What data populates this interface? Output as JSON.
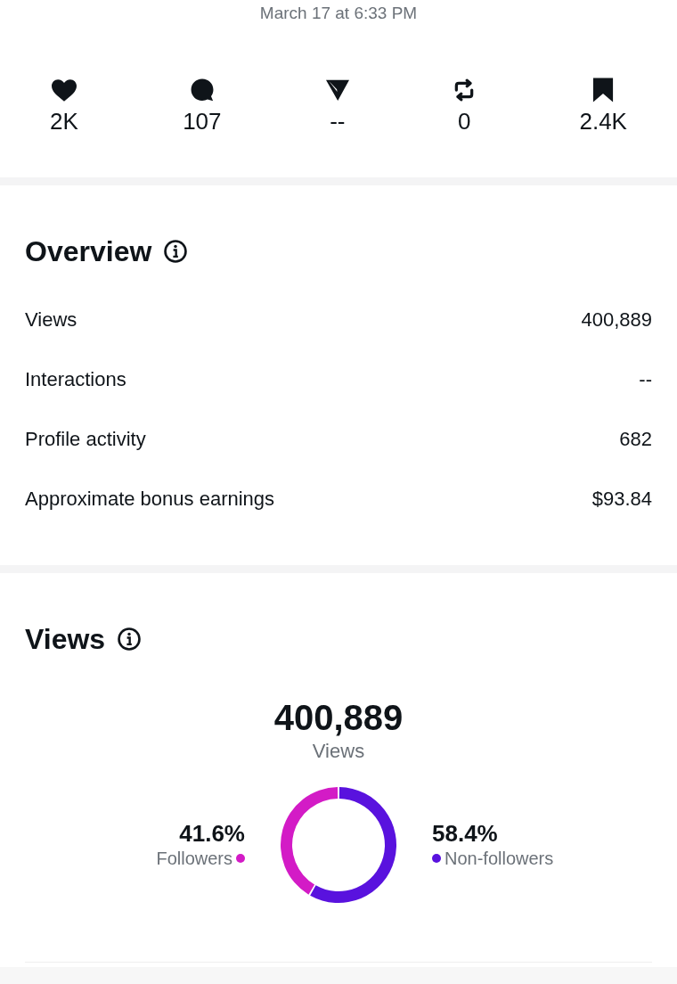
{
  "post": {
    "timestamp": "March 17 at 6:33 PM"
  },
  "stats": [
    {
      "kind": "likes",
      "value": "2K"
    },
    {
      "kind": "comments",
      "value": "107"
    },
    {
      "kind": "shares",
      "value": "--"
    },
    {
      "kind": "reposts",
      "value": "0"
    },
    {
      "kind": "saves",
      "value": "2.4K"
    }
  ],
  "overview": {
    "title": "Overview",
    "rows": [
      {
        "label": "Views",
        "value": "400,889"
      },
      {
        "label": "Interactions",
        "value": "--"
      },
      {
        "label": "Profile activity",
        "value": "682"
      },
      {
        "label": "Approximate bonus earnings",
        "value": "$93.84"
      }
    ]
  },
  "views": {
    "title": "Views",
    "total": "400,889",
    "total_label": "Views",
    "legend": [
      {
        "percent": "41.6%",
        "color": "#d31bc6"
      },
      {
        "percent": "58.4%",
        "color": "#5912de"
      }
    ],
    "chart_data": {
      "type": "donut",
      "categories": [
        "Followers",
        "Non-followers"
      ],
      "values": [
        41.6,
        58.4
      ]
    }
  }
}
